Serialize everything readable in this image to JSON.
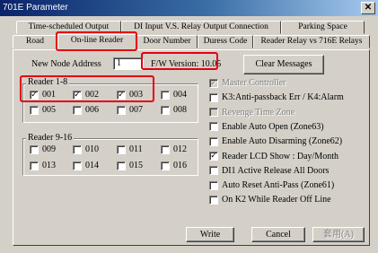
{
  "window": {
    "title": "701E Parameter",
    "close_symbol": "✕"
  },
  "tabs_back": [
    "Time-scheduled Output",
    "DI Input V.S. Relay Output Connection",
    "Parking Space"
  ],
  "tabs_front": [
    "Road",
    "On-line Reader",
    "Door Number",
    "Duress Code",
    "Reader Relay vs 716E Relays"
  ],
  "node": {
    "label": "New Node Address",
    "value": "1"
  },
  "fw_version": "F/W Version: 10.05",
  "clear_messages_label": "Clear Messages",
  "group1": {
    "title": "Reader 1-8",
    "items": [
      {
        "label": "001",
        "checked": true
      },
      {
        "label": "002",
        "checked": true
      },
      {
        "label": "003",
        "checked": true
      },
      {
        "label": "004",
        "checked": false
      },
      {
        "label": "005",
        "checked": false
      },
      {
        "label": "006",
        "checked": false
      },
      {
        "label": "007",
        "checked": false
      },
      {
        "label": "008",
        "checked": false
      }
    ]
  },
  "group2": {
    "title": "Reader 9-16",
    "items": [
      {
        "label": "009",
        "checked": false
      },
      {
        "label": "010",
        "checked": false
      },
      {
        "label": "011",
        "checked": false
      },
      {
        "label": "012",
        "checked": false
      },
      {
        "label": "013",
        "checked": false
      },
      {
        "label": "014",
        "checked": false
      },
      {
        "label": "015",
        "checked": false
      },
      {
        "label": "016",
        "checked": false
      }
    ]
  },
  "options": [
    {
      "label": "Master Controller",
      "checked": true,
      "disabled": true
    },
    {
      "label": "K3:Anti-passback Err / K4:Alarm",
      "checked": false,
      "disabled": false
    },
    {
      "label": "Revenge Time Zone",
      "checked": false,
      "disabled": true
    },
    {
      "label": "Enable Auto Open (Zone63)",
      "checked": false,
      "disabled": false
    },
    {
      "label": "Enable Auto Disarming (Zone62)",
      "checked": false,
      "disabled": false
    },
    {
      "label": "Reader LCD Show : Day/Month",
      "checked": true,
      "disabled": false
    },
    {
      "label": "DI1 Active Release All Doors",
      "checked": false,
      "disabled": false
    },
    {
      "label": "Auto Reset Anti-Pass (Zone61)",
      "checked": false,
      "disabled": false
    },
    {
      "label": "On K2 While Reader Off Line",
      "checked": false,
      "disabled": false
    }
  ],
  "buttons": {
    "write": "Write",
    "cancel": "Cancel",
    "apply": "套用(A)"
  },
  "colors": {
    "highlight": "#e60012",
    "title_start": "#0a246a",
    "face": "#d4d0c8"
  }
}
